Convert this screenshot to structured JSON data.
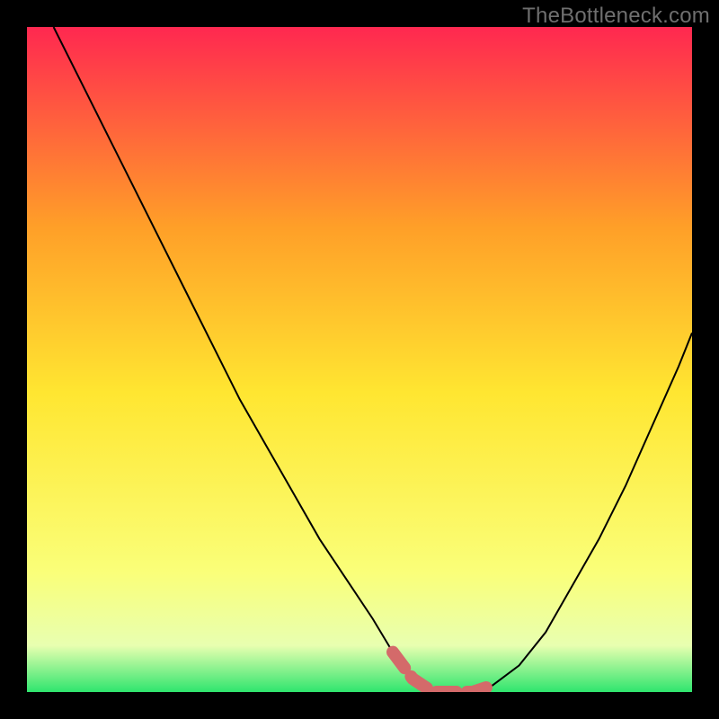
{
  "watermark": "TheBottleneck.com",
  "chart_data": {
    "type": "line",
    "title": "",
    "xlabel": "",
    "ylabel": "",
    "xlim": [
      0,
      100
    ],
    "ylim": [
      0,
      100
    ],
    "grid": false,
    "legend": false,
    "background_gradient": {
      "top": "#ff2850",
      "mid_upper": "#ff9f28",
      "mid": "#ffe631",
      "lower": "#faff79",
      "bottom": "#2fe56e"
    },
    "series": [
      {
        "name": "bottleneck-curve",
        "color": "#000000",
        "x": [
          4,
          8,
          12,
          16,
          20,
          24,
          28,
          32,
          36,
          40,
          44,
          48,
          52,
          55,
          58,
          61,
          64,
          67,
          70,
          74,
          78,
          82,
          86,
          90,
          94,
          98,
          100
        ],
        "y": [
          100,
          92,
          84,
          76,
          68,
          60,
          52,
          44,
          37,
          30,
          23,
          17,
          11,
          6,
          2,
          0,
          0,
          0,
          1,
          4,
          9,
          16,
          23,
          31,
          40,
          49,
          54
        ]
      }
    ],
    "highlight": {
      "name": "optimal-range",
      "color": "#d46a6a",
      "x": [
        55,
        58,
        61,
        64,
        67,
        70
      ],
      "y": [
        6,
        2,
        0,
        0,
        0,
        1
      ]
    }
  }
}
